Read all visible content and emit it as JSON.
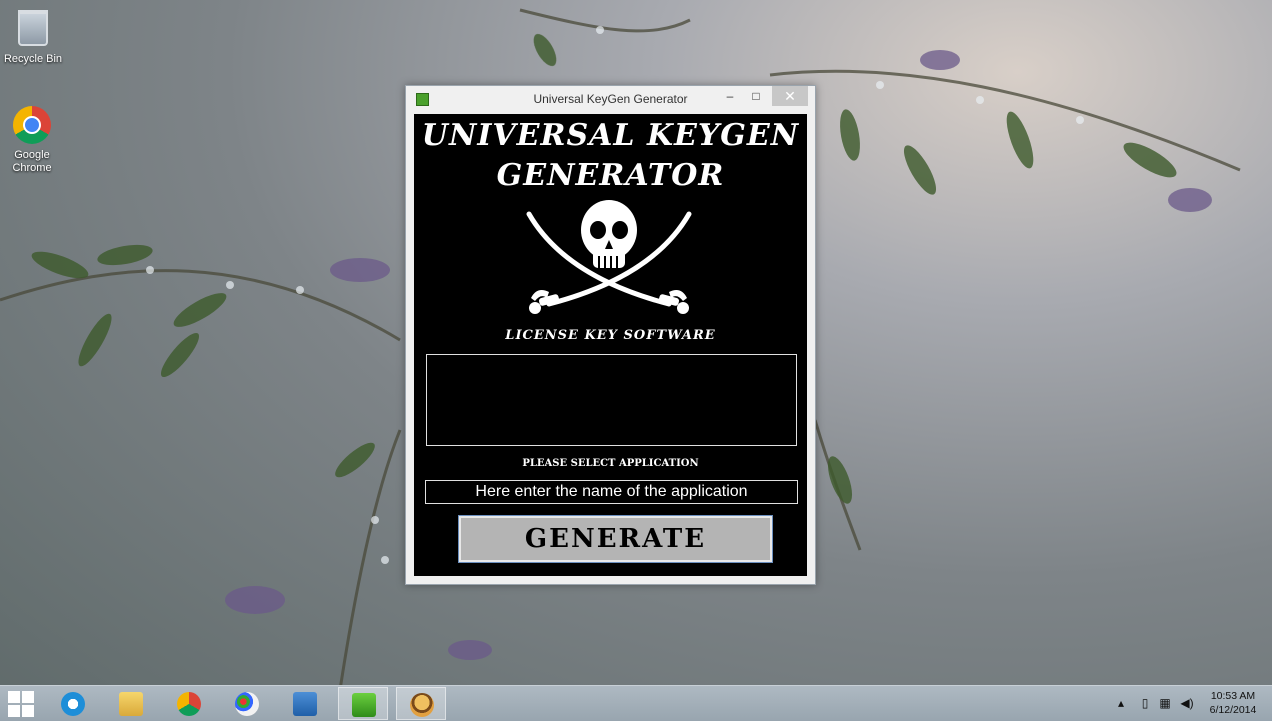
{
  "desktop": {
    "icons": [
      {
        "label": "Recycle Bin"
      },
      {
        "label": "Google Chrome"
      }
    ]
  },
  "window": {
    "title": "Universal KeyGen Generator",
    "controls": {
      "minimize": "–",
      "maximize": "□",
      "close": "✕"
    },
    "banner_line1": "UNIVERSAL KEYGEN",
    "banner_line2": "GENERATOR",
    "subtitle": "LICENSE KEY SOFTWARE",
    "select_label": "PLEASE SELECT APPLICATION",
    "app_input": {
      "value": "",
      "placeholder": "Here enter the name of the application"
    },
    "generate_label": "GENERATE",
    "logo_icon": "skull-crossed-swords-icon"
  },
  "taskbar": {
    "apps": [
      "internet-explorer-icon",
      "file-explorer-icon",
      "chrome-icon",
      "paint-icon",
      "remote-desktop-icon",
      "keygen-app-icon",
      "burger-app-icon"
    ],
    "tray_icons": [
      "show-hidden-icon",
      "battery-icon",
      "network-icon",
      "volume-icon"
    ],
    "time": "10:53 AM",
    "date": "6/12/2014"
  },
  "colors": {
    "window_client_bg": "#000000",
    "button_bg": "#b4b4b4",
    "close_button_bg": "#c7c7c7"
  }
}
